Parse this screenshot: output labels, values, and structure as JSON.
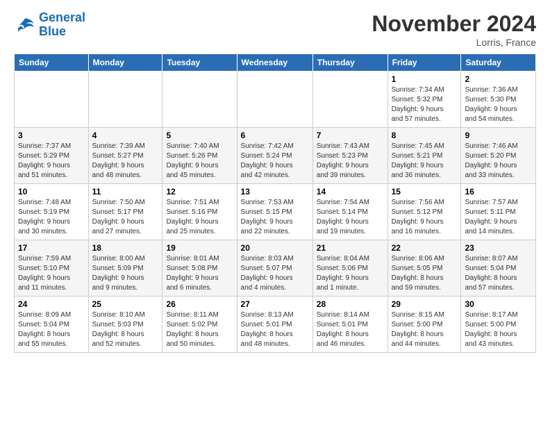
{
  "header": {
    "logo_line1": "General",
    "logo_line2": "Blue",
    "title": "November 2024",
    "subtitle": "Lorris, France"
  },
  "calendar": {
    "headers": [
      "Sunday",
      "Monday",
      "Tuesday",
      "Wednesday",
      "Thursday",
      "Friday",
      "Saturday"
    ],
    "rows": [
      [
        {
          "day": "",
          "info": ""
        },
        {
          "day": "",
          "info": ""
        },
        {
          "day": "",
          "info": ""
        },
        {
          "day": "",
          "info": ""
        },
        {
          "day": "",
          "info": ""
        },
        {
          "day": "1",
          "info": "Sunrise: 7:34 AM\nSunset: 5:32 PM\nDaylight: 9 hours\nand 57 minutes."
        },
        {
          "day": "2",
          "info": "Sunrise: 7:36 AM\nSunset: 5:30 PM\nDaylight: 9 hours\nand 54 minutes."
        }
      ],
      [
        {
          "day": "3",
          "info": "Sunrise: 7:37 AM\nSunset: 5:29 PM\nDaylight: 9 hours\nand 51 minutes."
        },
        {
          "day": "4",
          "info": "Sunrise: 7:39 AM\nSunset: 5:27 PM\nDaylight: 9 hours\nand 48 minutes."
        },
        {
          "day": "5",
          "info": "Sunrise: 7:40 AM\nSunset: 5:26 PM\nDaylight: 9 hours\nand 45 minutes."
        },
        {
          "day": "6",
          "info": "Sunrise: 7:42 AM\nSunset: 5:24 PM\nDaylight: 9 hours\nand 42 minutes."
        },
        {
          "day": "7",
          "info": "Sunrise: 7:43 AM\nSunset: 5:23 PM\nDaylight: 9 hours\nand 39 minutes."
        },
        {
          "day": "8",
          "info": "Sunrise: 7:45 AM\nSunset: 5:21 PM\nDaylight: 9 hours\nand 36 minutes."
        },
        {
          "day": "9",
          "info": "Sunrise: 7:46 AM\nSunset: 5:20 PM\nDaylight: 9 hours\nand 33 minutes."
        }
      ],
      [
        {
          "day": "10",
          "info": "Sunrise: 7:48 AM\nSunset: 5:19 PM\nDaylight: 9 hours\nand 30 minutes."
        },
        {
          "day": "11",
          "info": "Sunrise: 7:50 AM\nSunset: 5:17 PM\nDaylight: 9 hours\nand 27 minutes."
        },
        {
          "day": "12",
          "info": "Sunrise: 7:51 AM\nSunset: 5:16 PM\nDaylight: 9 hours\nand 25 minutes."
        },
        {
          "day": "13",
          "info": "Sunrise: 7:53 AM\nSunset: 5:15 PM\nDaylight: 9 hours\nand 22 minutes."
        },
        {
          "day": "14",
          "info": "Sunrise: 7:54 AM\nSunset: 5:14 PM\nDaylight: 9 hours\nand 19 minutes."
        },
        {
          "day": "15",
          "info": "Sunrise: 7:56 AM\nSunset: 5:12 PM\nDaylight: 9 hours\nand 16 minutes."
        },
        {
          "day": "16",
          "info": "Sunrise: 7:57 AM\nSunset: 5:11 PM\nDaylight: 9 hours\nand 14 minutes."
        }
      ],
      [
        {
          "day": "17",
          "info": "Sunrise: 7:59 AM\nSunset: 5:10 PM\nDaylight: 9 hours\nand 11 minutes."
        },
        {
          "day": "18",
          "info": "Sunrise: 8:00 AM\nSunset: 5:09 PM\nDaylight: 9 hours\nand 9 minutes."
        },
        {
          "day": "19",
          "info": "Sunrise: 8:01 AM\nSunset: 5:08 PM\nDaylight: 9 hours\nand 6 minutes."
        },
        {
          "day": "20",
          "info": "Sunrise: 8:03 AM\nSunset: 5:07 PM\nDaylight: 9 hours\nand 4 minutes."
        },
        {
          "day": "21",
          "info": "Sunrise: 8:04 AM\nSunset: 5:06 PM\nDaylight: 9 hours\nand 1 minute."
        },
        {
          "day": "22",
          "info": "Sunrise: 8:06 AM\nSunset: 5:05 PM\nDaylight: 8 hours\nand 59 minutes."
        },
        {
          "day": "23",
          "info": "Sunrise: 8:07 AM\nSunset: 5:04 PM\nDaylight: 8 hours\nand 57 minutes."
        }
      ],
      [
        {
          "day": "24",
          "info": "Sunrise: 8:09 AM\nSunset: 5:04 PM\nDaylight: 8 hours\nand 55 minutes."
        },
        {
          "day": "25",
          "info": "Sunrise: 8:10 AM\nSunset: 5:03 PM\nDaylight: 8 hours\nand 52 minutes."
        },
        {
          "day": "26",
          "info": "Sunrise: 8:11 AM\nSunset: 5:02 PM\nDaylight: 8 hours\nand 50 minutes."
        },
        {
          "day": "27",
          "info": "Sunrise: 8:13 AM\nSunset: 5:01 PM\nDaylight: 8 hours\nand 48 minutes."
        },
        {
          "day": "28",
          "info": "Sunrise: 8:14 AM\nSunset: 5:01 PM\nDaylight: 8 hours\nand 46 minutes."
        },
        {
          "day": "29",
          "info": "Sunrise: 8:15 AM\nSunset: 5:00 PM\nDaylight: 8 hours\nand 44 minutes."
        },
        {
          "day": "30",
          "info": "Sunrise: 8:17 AM\nSunset: 5:00 PM\nDaylight: 8 hours\nand 43 minutes."
        }
      ]
    ]
  }
}
